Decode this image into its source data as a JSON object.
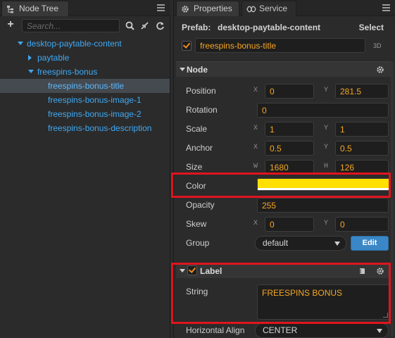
{
  "left_panel": {
    "tab_label": "Node Tree",
    "search_placeholder": "Search...",
    "tree": [
      {
        "label": "desktop-paytable-content",
        "arrow": "down",
        "selected": false
      },
      {
        "label": "paytable",
        "arrow": "right",
        "selected": false
      },
      {
        "label": "freespins-bonus",
        "arrow": "down",
        "selected": false
      },
      {
        "label": "freespins-bonus-title",
        "arrow": "none",
        "selected": true
      },
      {
        "label": "freespins-bonus-image-1",
        "arrow": "none",
        "selected": false
      },
      {
        "label": "freespins-bonus-image-2",
        "arrow": "none",
        "selected": false
      },
      {
        "label": "freespins-bonus-description",
        "arrow": "none",
        "selected": false
      }
    ]
  },
  "right_panel": {
    "tabs": [
      {
        "label": "Properties",
        "icon": "gear-icon",
        "active": true
      },
      {
        "label": "Service",
        "icon": "service-icon",
        "active": false
      }
    ],
    "prefab": {
      "label": "Prefab:",
      "name": "desktop-paytable-content",
      "select_label": "Select"
    },
    "node_name": "freespins-bonus-title",
    "badge_3d": "3D",
    "node_section": {
      "title": "Node",
      "position": {
        "label": "Position",
        "x_axis": "X",
        "x": "0",
        "y_axis": "Y",
        "y": "281.5"
      },
      "rotation": {
        "label": "Rotation",
        "value": "0"
      },
      "scale": {
        "label": "Scale",
        "x_axis": "X",
        "x": "1",
        "y_axis": "Y",
        "y": "1"
      },
      "anchor": {
        "label": "Anchor",
        "x_axis": "X",
        "x": "0.5",
        "y_axis": "Y",
        "y": "0.5"
      },
      "size": {
        "label": "Size",
        "w_axis": "W",
        "w": "1680",
        "h_axis": "H",
        "h": "126"
      },
      "color": {
        "label": "Color",
        "value": "#ffe000"
      },
      "opacity": {
        "label": "Opacity",
        "value": "255"
      },
      "skew": {
        "label": "Skew",
        "x_axis": "X",
        "x": "0",
        "y_axis": "Y",
        "y": "0"
      },
      "group": {
        "label": "Group",
        "value": "default",
        "edit_label": "Edit"
      }
    },
    "label_section": {
      "title": "Label",
      "string": {
        "label": "String",
        "value": "FREESPINS BONUS"
      },
      "horizontal_align": {
        "label": "Horizontal Align",
        "value": "CENTER"
      }
    }
  },
  "colors": {
    "tree_link": "#3fa9f5",
    "value_text": "#f5a623",
    "highlight": "#e0141e",
    "edit_button": "#3a87c7",
    "swatch": "#ffe000"
  }
}
